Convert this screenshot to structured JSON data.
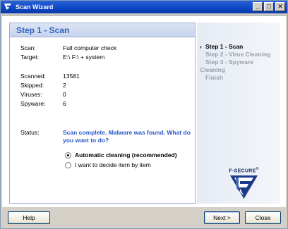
{
  "window": {
    "title": "Scan Wizard",
    "minimize": "_",
    "maximize": "□",
    "close": "✕"
  },
  "header": {
    "title": "Step 1 - Scan"
  },
  "details": {
    "scan_label": "Scan:",
    "scan_value": "Full computer check",
    "target_label": "Target:",
    "target_value": "E:\\ F:\\  + system",
    "scanned_label": "Scanned:",
    "scanned_value": "13581",
    "skipped_label": "Skipped:",
    "skipped_value": "2",
    "viruses_label": "Viruses:",
    "viruses_value": "0",
    "spyware_label": "Spyware:",
    "spyware_value": "6",
    "status_label": "Status:",
    "status_value": "Scan complete. Malware was found. What do you want to do?"
  },
  "options": {
    "auto": "Automatic cleaning (recommended)",
    "manual": "I want to decide item by item",
    "selected": "auto"
  },
  "steps": [
    {
      "label": "Step 1 - Scan",
      "active": true
    },
    {
      "label": "Step 2 - Virus Cleaning",
      "active": false
    },
    {
      "label": "Step 3 - Spyware Cleaning",
      "active": false
    },
    {
      "label": "Finish",
      "active": false
    }
  ],
  "logo": {
    "text": "F-SECURE",
    "mark": "®"
  },
  "buttons": {
    "help": "Help",
    "next": "Next >",
    "close": "Close"
  },
  "colors": {
    "accent": "#3060c0",
    "status_text": "#2a56c6",
    "titlebar": "#0c46c4"
  }
}
